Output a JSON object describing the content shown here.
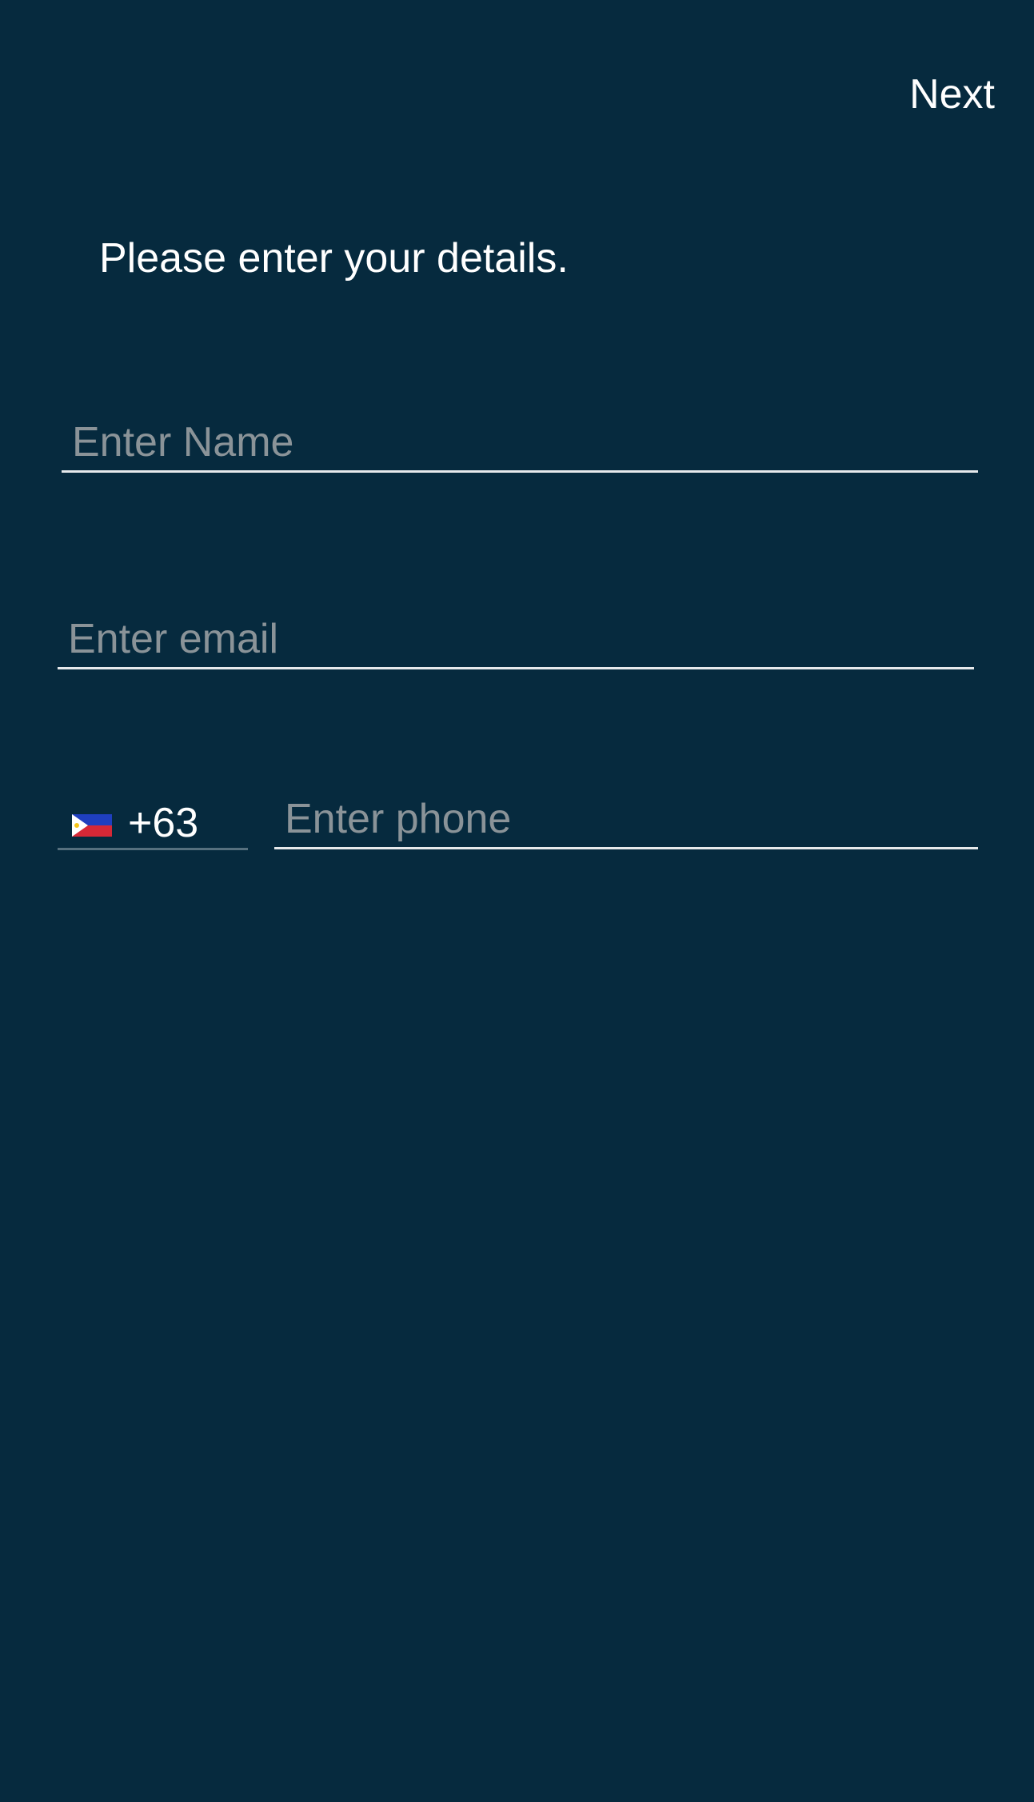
{
  "header": {
    "next_label": "Next"
  },
  "form": {
    "prompt": "Please enter your details.",
    "name": {
      "placeholder": "Enter Name",
      "value": ""
    },
    "email": {
      "placeholder": "Enter email",
      "value": ""
    },
    "phone": {
      "country_flag": "philippines-flag-icon",
      "dial_code": "+63",
      "placeholder": "Enter phone",
      "value": ""
    }
  },
  "colors": {
    "background": "#062a3e",
    "text": "#ffffff",
    "placeholder": "#8a9398",
    "underline": "#e6e9eb"
  }
}
